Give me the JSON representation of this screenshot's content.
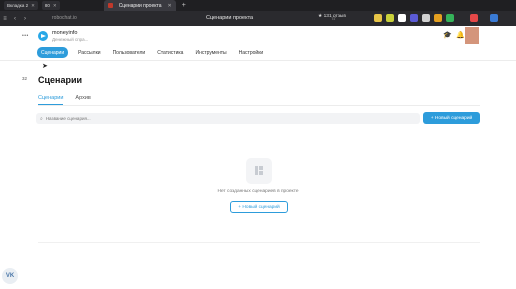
{
  "browser": {
    "tabs": [
      {
        "label": "Вкладка 2"
      },
      {
        "label": "80"
      }
    ],
    "active_tab": {
      "label": "Сценарии проекта"
    },
    "url": "robochat.io",
    "page_title": "Сценарии проекта",
    "reviews": "★ 131 отзыв",
    "extension_colors": [
      "#e8c547",
      "#c9d13a",
      "#ffffff",
      "#5b5bd6",
      "#d1d1d1",
      "#e5a020",
      "#35b35a",
      "#e54848",
      "#3a7bd5"
    ]
  },
  "header": {
    "menu_icon": "dots-menu-icon",
    "project_name": "moneyinfo",
    "project_subtitle": "Денежный спра..."
  },
  "topnav": {
    "items": [
      {
        "label": "Сценарии"
      },
      {
        "label": "Рассылки"
      },
      {
        "label": "Пользователи"
      },
      {
        "label": "Статистика"
      },
      {
        "label": "Инструменты"
      },
      {
        "label": "Настройки"
      }
    ]
  },
  "rail": {
    "badge": "32"
  },
  "main": {
    "title": "Сценарии",
    "tabs": [
      {
        "label": "Сценарии"
      },
      {
        "label": "Архив"
      }
    ],
    "search_placeholder": "Название сценария...",
    "new_button": "+ Новый сценарий",
    "empty_text": "Нет созданных сценариев в проекте",
    "empty_button": "+ Новый сценарий"
  },
  "footer": {
    "vk": "VK"
  }
}
